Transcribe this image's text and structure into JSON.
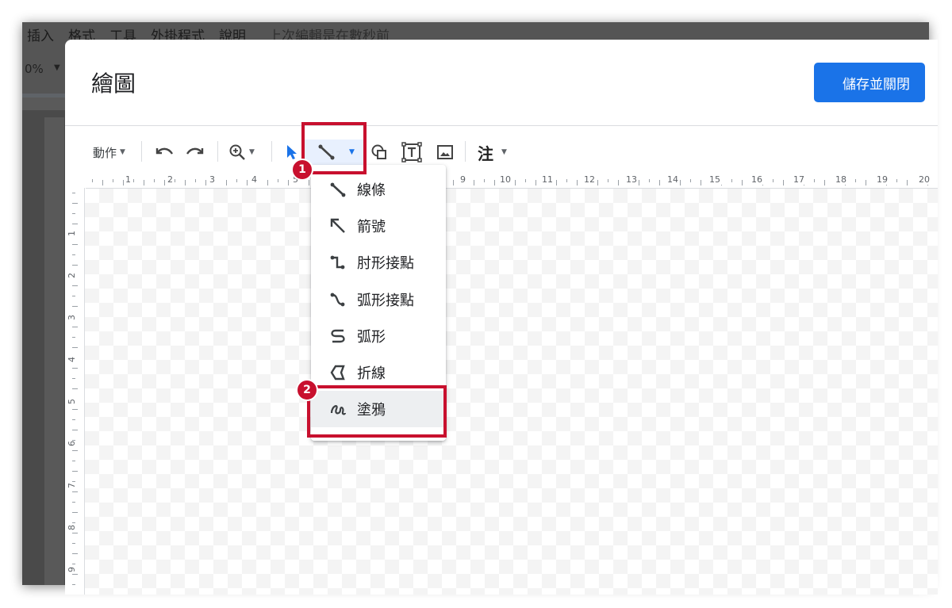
{
  "docs": {
    "menubar": [
      "插入",
      "格式",
      "工具",
      "外掛程式",
      "說明"
    ],
    "last_edit": "上次編輯是在數秒前",
    "zoom": "0%"
  },
  "dialog": {
    "title": "繪圖",
    "save_button": "儲存並關閉"
  },
  "toolbar": {
    "actions_label": "動作",
    "notes_label": "注"
  },
  "line_menu": {
    "items": [
      {
        "label": "線條",
        "icon": "line-icon"
      },
      {
        "label": "箭號",
        "icon": "arrow-icon"
      },
      {
        "label": "肘形接點",
        "icon": "elbow-connector-icon"
      },
      {
        "label": "弧形接點",
        "icon": "curved-connector-icon"
      },
      {
        "label": "弧形",
        "icon": "curve-icon"
      },
      {
        "label": "折線",
        "icon": "polyline-icon"
      },
      {
        "label": "塗鴉",
        "icon": "scribble-icon"
      }
    ],
    "active_item": "塗鴉"
  },
  "annotations": {
    "step1": "1",
    "step2": "2",
    "highlight_color": "#c8102e"
  },
  "rulers": {
    "horizontal": [
      "1",
      "2",
      "3",
      "4",
      "5",
      "9",
      "10",
      "11",
      "12",
      "13",
      "14",
      "15",
      "16",
      "17",
      "18",
      "19",
      "20"
    ],
    "vertical": [
      "1",
      "2",
      "3",
      "4",
      "5",
      "6",
      "7",
      "8",
      "9"
    ]
  },
  "colors": {
    "primary_button": "#1a73e8",
    "selected_tool_bg": "#e8f0fe"
  }
}
